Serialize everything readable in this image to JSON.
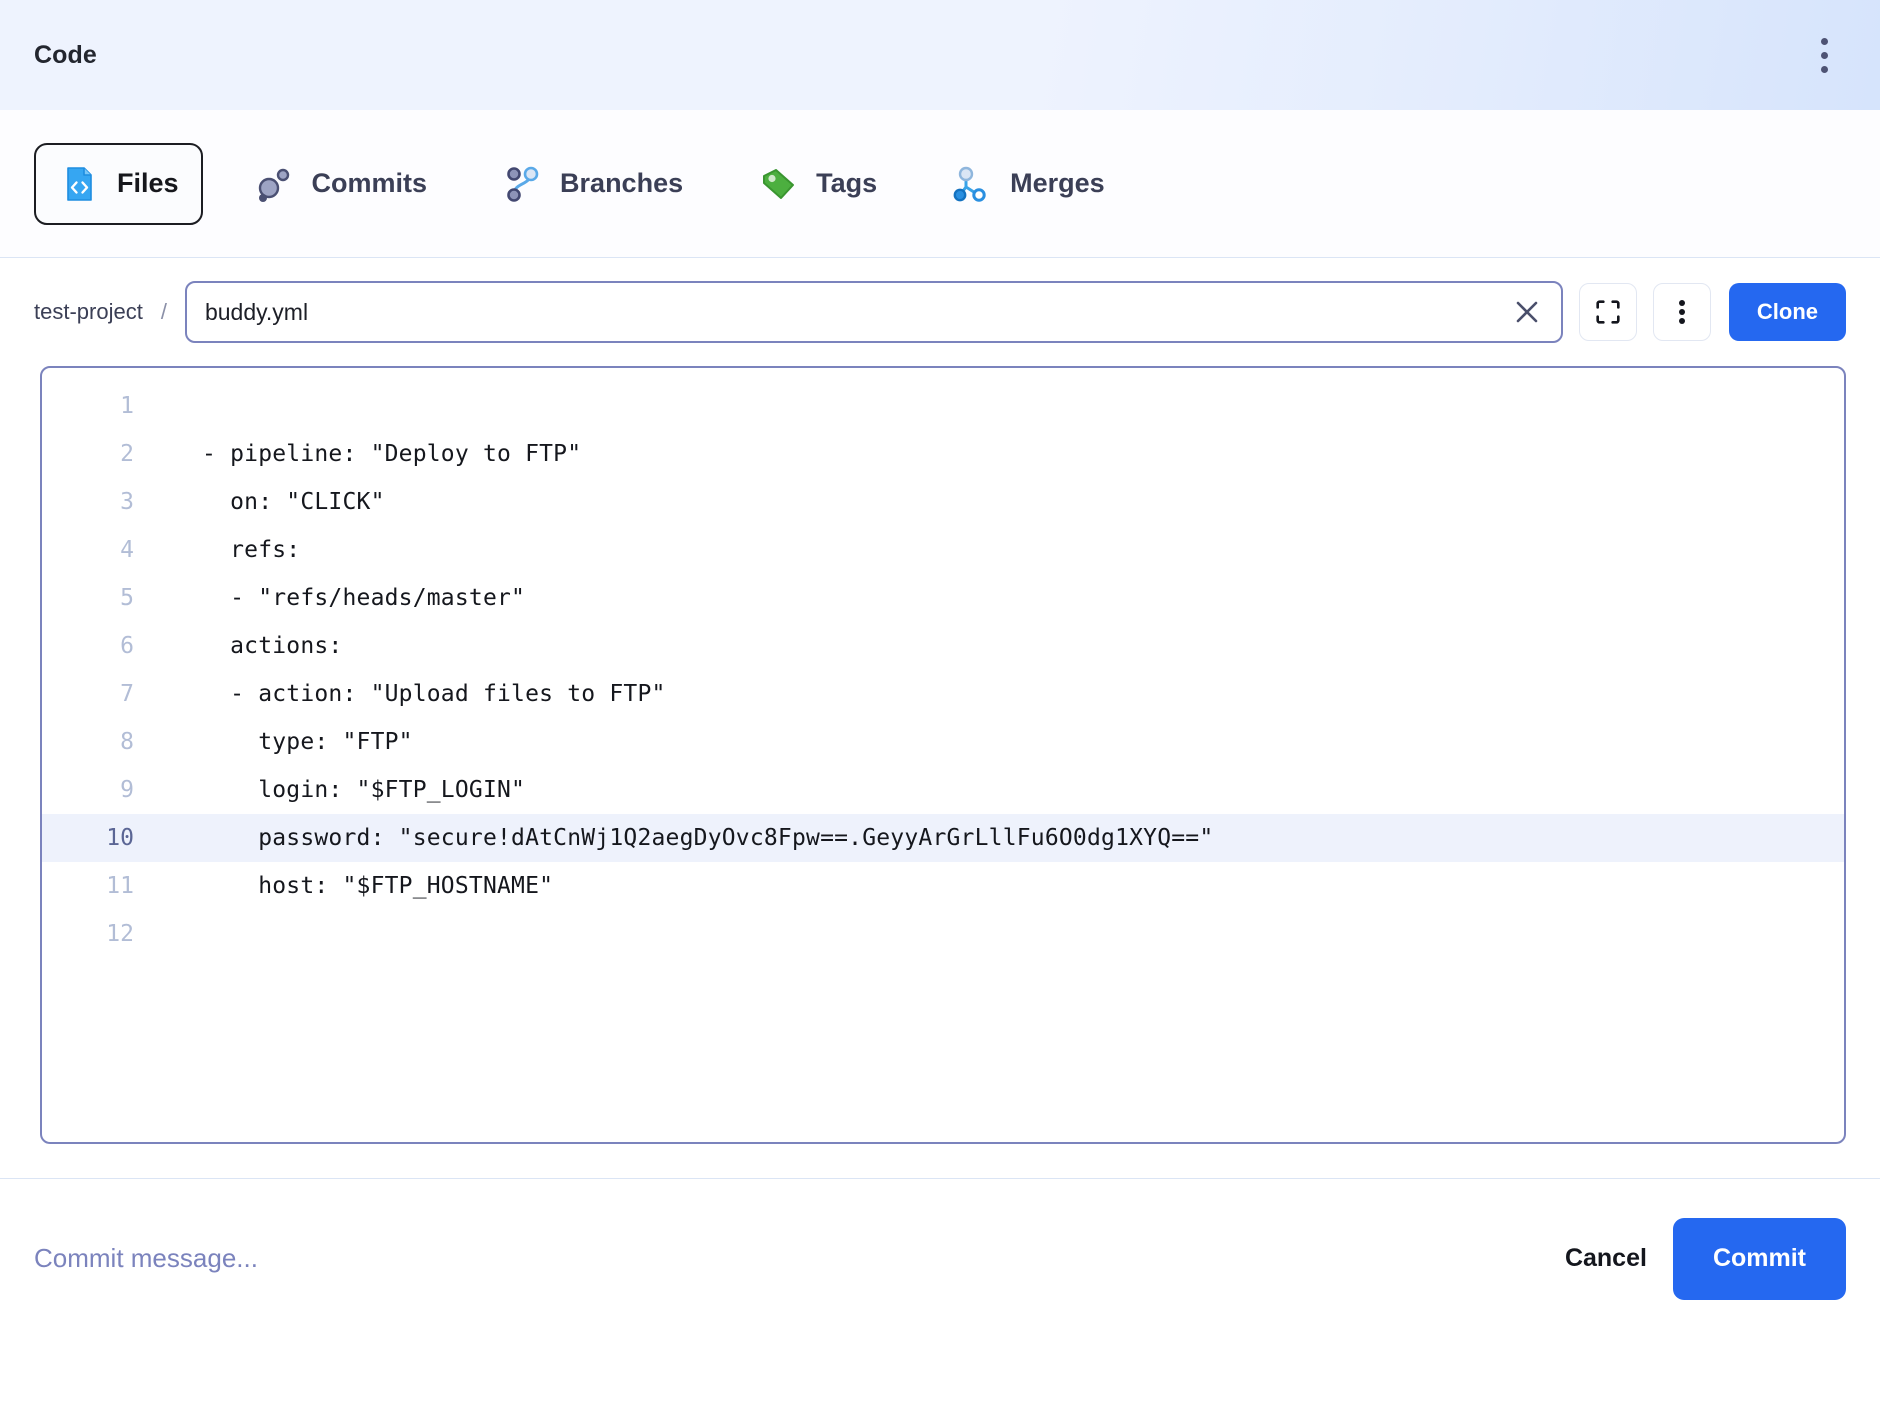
{
  "header": {
    "title": "Code",
    "menu_icon": "kebab-menu-icon"
  },
  "tabs": [
    {
      "label": "Files",
      "icon": "code-file-icon",
      "active": true
    },
    {
      "label": "Commits",
      "icon": "commits-icon",
      "active": false
    },
    {
      "label": "Branches",
      "icon": "branches-icon",
      "active": false
    },
    {
      "label": "Tags",
      "icon": "tag-icon",
      "active": false
    },
    {
      "label": "Merges",
      "icon": "merges-icon",
      "active": false
    }
  ],
  "pathbar": {
    "project": "test-project",
    "separator": "/",
    "file_value": "buddy.yml",
    "file_placeholder": "buddy.yml",
    "clear_icon": "close-x-icon",
    "fullscreen_icon": "fullscreen-expand-icon",
    "more_icon": "kebab-menu-icon",
    "clone_label": "Clone"
  },
  "editor": {
    "lines": [
      {
        "n": "1",
        "text": "",
        "highlight": false
      },
      {
        "n": "2",
        "text": "- pipeline: \"Deploy to FTP\"",
        "highlight": false
      },
      {
        "n": "3",
        "text": "  on: \"CLICK\"",
        "highlight": false
      },
      {
        "n": "4",
        "text": "  refs:",
        "highlight": false
      },
      {
        "n": "5",
        "text": "  - \"refs/heads/master\"",
        "highlight": false
      },
      {
        "n": "6",
        "text": "  actions:",
        "highlight": false
      },
      {
        "n": "7",
        "text": "  - action: \"Upload files to FTP\"",
        "highlight": false
      },
      {
        "n": "8",
        "text": "    type: \"FTP\"",
        "highlight": false
      },
      {
        "n": "9",
        "text": "    login: \"$FTP_LOGIN\"",
        "highlight": false
      },
      {
        "n": "10",
        "text": "    password: \"secure!dAtCnWj1Q2aegDyOvc8Fpw==.GeyyArGrLllFu6O0dg1XYQ==\"",
        "highlight": true
      },
      {
        "n": "11",
        "text": "    host: \"$FTP_HOSTNAME\"",
        "highlight": false
      },
      {
        "n": "12",
        "text": "",
        "highlight": false
      }
    ]
  },
  "footer": {
    "commit_message_value": "",
    "commit_message_placeholder": "Commit message...",
    "cancel_label": "Cancel",
    "commit_label": "Commit"
  },
  "colors": {
    "accent_blue": "#2568f0",
    "tag_green": "#4caf3f",
    "file_icon_blue": "#36a6f2",
    "border_indigo": "#7b83bd",
    "highlight_row": "#eef2fc"
  }
}
